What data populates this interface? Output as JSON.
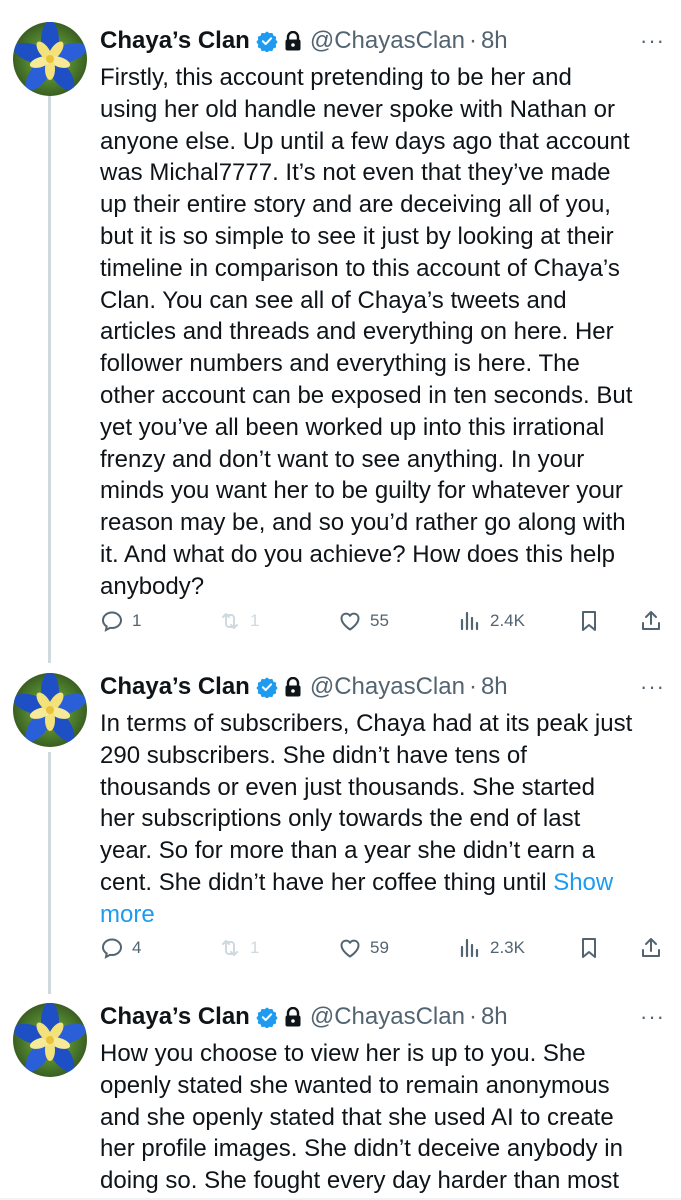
{
  "tweets": [
    {
      "name": "Chaya’s Clan",
      "handle": "@ChayasClan",
      "sep": "·",
      "time": "8h",
      "more": "···",
      "lines": [
        "Firstly, this account pretending to be her and",
        "using her old handle never spoke with Nathan or",
        "anyone else. Up until a few days ago that account",
        "was Michal7777. It’s not even that they’ve made",
        "up their entire story and are deceiving all of you,",
        "but it is so simple to see it just by looking at their",
        "timeline in comparison to this account of Chaya’s",
        "Clan. You can see all of Chaya’s tweets and",
        "articles and threads and everything on here. Her",
        "follower numbers and everything is here. The",
        "other account can be exposed in ten seconds. But",
        "yet you’ve all been worked up into this irrational",
        "frenzy and don’t want to see anything. In your",
        "minds you want her to be guilty for whatever your",
        "reason may be, and so you’d rather go along with",
        "it. And what do you achieve? How does this help",
        "anybody?"
      ],
      "replies": "1",
      "reposts": "1",
      "likes": "55",
      "views": "2.4K"
    },
    {
      "name": "Chaya’s Clan",
      "handle": "@ChayasClan",
      "sep": "·",
      "time": "8h",
      "more": "···",
      "lines": [
        "In terms of subscribers, Chaya had at its peak just",
        "290 subscribers. She didn’t have tens of",
        "thousands or even just thousands. She started",
        "her subscriptions only towards the end of last",
        "year. So for more than a year she didn’t earn a",
        "cent. She didn’t have her coffee thing until"
      ],
      "show_more_1": "Show",
      "show_more_2": "more",
      "replies": "4",
      "reposts": "1",
      "likes": "59",
      "views": "2.3K"
    },
    {
      "name": "Chaya’s Clan",
      "handle": "@ChayasClan",
      "sep": "·",
      "time": "8h",
      "more": "···",
      "lines": [
        "How you choose to view her is up to you. She",
        "openly stated she wanted to remain anonymous",
        "and she openly stated that she used AI to create",
        "her profile images. She didn’t deceive anybody in",
        "doing so. She fought every day harder than most"
      ]
    }
  ],
  "colors": {
    "text": "#0f1419",
    "secondary": "#536471",
    "link": "#1d9bf0",
    "verified": "#1d9bf0",
    "disabled": "#cfd9de"
  },
  "icons": [
    "verified-badge-icon",
    "lock-icon",
    "more-icon",
    "reply-icon",
    "repost-icon",
    "like-icon",
    "views-icon",
    "bookmark-icon",
    "share-icon"
  ]
}
